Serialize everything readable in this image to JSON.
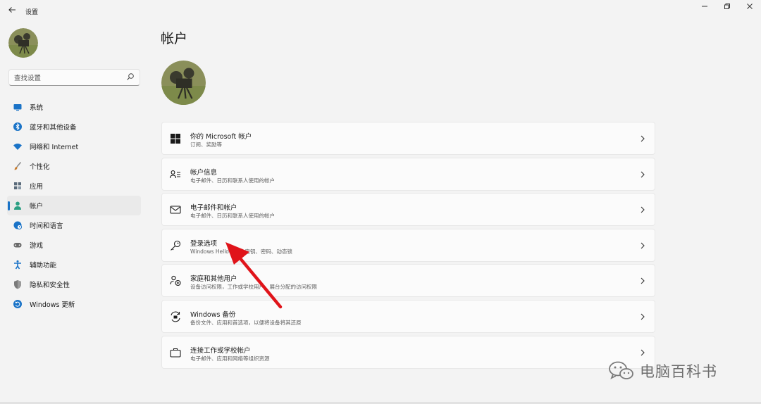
{
  "window": {
    "title": "设置",
    "back_icon": "arrow-left-icon",
    "controls": [
      "minimize-icon",
      "restore-icon",
      "close-icon"
    ]
  },
  "sidebar": {
    "search": {
      "placeholder": "查找设置",
      "value": ""
    },
    "items": [
      {
        "label": "系统",
        "icon": "monitor-icon",
        "color": "#1a73c7"
      },
      {
        "label": "蓝牙和其他设备",
        "icon": "bluetooth-icon",
        "color": "#1a73c7"
      },
      {
        "label": "网络和 Internet",
        "icon": "wifi-icon",
        "color": "#1a73c7"
      },
      {
        "label": "个性化",
        "icon": "brush-icon",
        "color": "#c77b2c"
      },
      {
        "label": "应用",
        "icon": "apps-icon",
        "color": "#5a6a7a"
      },
      {
        "label": "帐户",
        "icon": "person-icon",
        "color": "#2b9f83",
        "active": true
      },
      {
        "label": "时间和语言",
        "icon": "globe-clock-icon",
        "color": "#1a73c7"
      },
      {
        "label": "游戏",
        "icon": "gamepad-icon",
        "color": "#6a6a6a"
      },
      {
        "label": "辅助功能",
        "icon": "accessibility-icon",
        "color": "#1a73c7"
      },
      {
        "label": "隐私和安全性",
        "icon": "shield-icon",
        "color": "#7a7a7a"
      },
      {
        "label": "Windows 更新",
        "icon": "update-icon",
        "color": "#1a73c7"
      }
    ]
  },
  "main": {
    "title": "帐户",
    "cards": [
      {
        "title": "你的 Microsoft 帐户",
        "subtitle": "订阅、奖励等",
        "icon": "microsoft-logo-icon"
      },
      {
        "title": "帐户信息",
        "subtitle": "电子邮件、日历和联系人使用的帐户",
        "icon": "person-card-icon"
      },
      {
        "title": "电子邮件和帐户",
        "subtitle": "电子邮件、日历和联系人使用的帐户",
        "icon": "mail-icon"
      },
      {
        "title": "登录选项",
        "subtitle": "Windows Hello、安全密钥、密码、动态锁",
        "icon": "key-icon"
      },
      {
        "title": "家庭和其他用户",
        "subtitle": "设备访问权限，工作或学校用户，展台分配的访问权限",
        "icon": "family-icon"
      },
      {
        "title": "Windows 备份",
        "subtitle": "备份文件、应用和首选项，以便将设备将其还原",
        "icon": "backup-icon"
      },
      {
        "title": "连接工作或学校帐户",
        "subtitle": "电子邮件、应用和网络等组织资源",
        "icon": "briefcase-icon"
      }
    ]
  },
  "annotation": {
    "arrow_color": "#e0141a"
  },
  "watermark": {
    "text": "电脑百科书",
    "icon": "wechat-icon"
  }
}
